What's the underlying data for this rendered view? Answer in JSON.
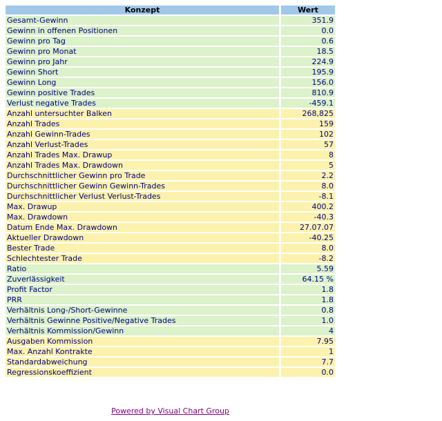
{
  "table": {
    "headers": {
      "konzept": "Konzept",
      "wert": "Wert"
    },
    "rows": [
      {
        "konzept": "Gesamt-Gewinn",
        "wert": "351.9"
      },
      {
        "konzept": "Gewinn in offenen Positionen",
        "wert": "0.0"
      },
      {
        "konzept": "Gewinn pro Tag",
        "wert": "0.6"
      },
      {
        "konzept": "Gewinn pro Monat",
        "wert": "18.5"
      },
      {
        "konzept": "Gewinn pro Jahr",
        "wert": "224.9"
      },
      {
        "konzept": "Gewinn Short",
        "wert": "195.9"
      },
      {
        "konzept": "Gewinn Long",
        "wert": "156.0"
      },
      {
        "konzept": "Gewinn positive Trades",
        "wert": "810.9"
      },
      {
        "konzept": "Verlust negative Trades",
        "wert": "-459.1"
      },
      {
        "konzept": "Anzahl untersuchter Balken",
        "wert": "268,825"
      },
      {
        "konzept": "Anzahl Trades",
        "wert": "159"
      },
      {
        "konzept": "Anzahl Gewinn-Trades",
        "wert": "102"
      },
      {
        "konzept": "Anzahl Verlust-Trades",
        "wert": "57"
      },
      {
        "konzept": "Anzahl Trades Max. Drawup",
        "wert": "8"
      },
      {
        "konzept": "Anzahl Trades Max. Drawdown",
        "wert": "5"
      },
      {
        "konzept": "Durchschnittlicher Gewinn pro Trade",
        "wert": "2.2"
      },
      {
        "konzept": "Durchschnittlicher Gewinn Gewinn-Trades",
        "wert": "8.0"
      },
      {
        "konzept": "Durchschnittlicher Verlust Verlust-Trades",
        "wert": "-8.1"
      },
      {
        "konzept": "Max. Drawup",
        "wert": "400.2"
      },
      {
        "konzept": "Max. Drawdown",
        "wert": "-40.3"
      },
      {
        "konzept": "Datum Ende Max. Drawdown",
        "wert": "27.07.07"
      },
      {
        "konzept": "Aktueller Drawdown",
        "wert": "-40.25"
      },
      {
        "konzept": "Bester Trade",
        "wert": "8.0"
      },
      {
        "konzept": "Schlechtester Trade",
        "wert": "-8.2"
      },
      {
        "konzept": "Ratio",
        "wert": "5.59"
      },
      {
        "konzept": "Zuverlässigkeit",
        "wert": "64.15 %"
      },
      {
        "konzept": "Profit Factor",
        "wert": "1.8"
      },
      {
        "konzept": "PRR",
        "wert": "1.8"
      },
      {
        "konzept": "Verhältnis Long-/Short-Gewinne",
        "wert": "0.8"
      },
      {
        "konzept": "Verhältnis Gewinne Positive/Negative Trades",
        "wert": "1.0"
      },
      {
        "konzept": "Verhältnis Kommission/Gewinn",
        "wert": "4"
      },
      {
        "konzept": "Ausgaben Kommission",
        "wert": "7.95"
      },
      {
        "konzept": "Max. Anzahl Kontrakte",
        "wert": "1"
      },
      {
        "konzept": "Standardabweichung",
        "wert": "7.7"
      },
      {
        "konzept": "Regressionskoeffizient",
        "wert": "0.0"
      }
    ]
  },
  "footer": {
    "link_label": "Powered by Visual Chart Group"
  },
  "colors": {
    "header_bg": "#a1c8e8",
    "green_row_bg": "#dcf2ca",
    "yellow_row_bg": "#fdf2ad",
    "row_text": "#000080",
    "header_text": "#000000",
    "link_text": "#80007f"
  }
}
